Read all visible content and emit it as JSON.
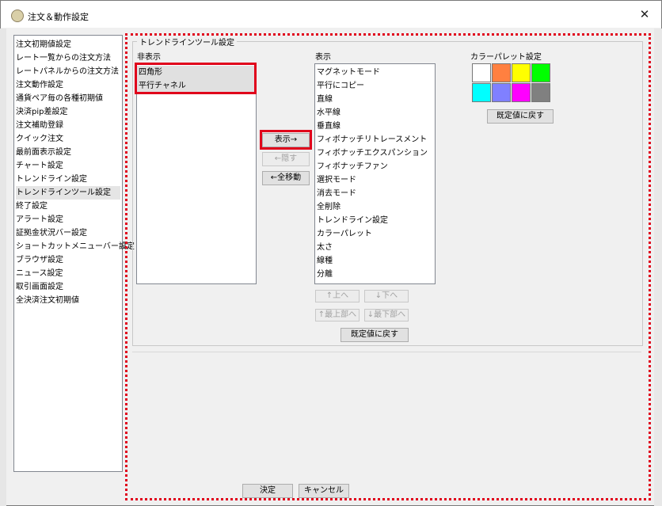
{
  "window": {
    "title": "注文＆動作設定",
    "close_glyph": "✕"
  },
  "nav": {
    "items": [
      {
        "label": "注文初期値設定"
      },
      {
        "label": "レート一覧からの注文方法"
      },
      {
        "label": "レートパネルからの注文方法"
      },
      {
        "label": "注文動作設定"
      },
      {
        "label": "通貨ペア毎の各種初期値"
      },
      {
        "label": "決済pip差設定"
      },
      {
        "label": "注文補助登録"
      },
      {
        "label": "クイック注文"
      },
      {
        "label": "最前面表示設定"
      },
      {
        "label": "チャート設定"
      },
      {
        "label": "トレンドライン設定"
      },
      {
        "label": "トレンドラインツール設定",
        "selected": true
      },
      {
        "label": "終了設定"
      },
      {
        "label": "アラート設定"
      },
      {
        "label": "証拠金状況バー設定"
      },
      {
        "label": "ショートカットメニューバー設定"
      },
      {
        "label": "ブラウザ設定"
      },
      {
        "label": "ニュース設定"
      },
      {
        "label": "取引画面設定"
      },
      {
        "label": "全決済注文初期値"
      }
    ]
  },
  "panel": {
    "group_title": "トレンドラインツール設定",
    "hidden": {
      "label": "非表示",
      "items": [
        "四角形",
        "平行チャネル"
      ]
    },
    "shown": {
      "label": "表示",
      "items": [
        "マグネットモード",
        "平行にコピー",
        "直線",
        "水平線",
        "垂直線",
        "フィボナッチリトレースメント",
        "フィボナッチエクスパンション",
        "フィボナッチファン",
        "選択モード",
        "消去モード",
        "全削除",
        "トレンドライン設定",
        "カラーパレット",
        "太さ",
        "線種",
        "分離"
      ]
    },
    "buttons": {
      "show": "表示→",
      "hide": "←隠す",
      "move_all": "←全移動",
      "up": "↑上へ",
      "down": "↓下へ",
      "top": "↑最上部へ",
      "bottom": "↓最下部へ",
      "reset_list": "既定値に戻す"
    },
    "palette": {
      "label": "カラーパレット設定",
      "colors": [
        "#ffffff",
        "#ff8040",
        "#ffff00",
        "#00ff00",
        "#00ffff",
        "#8080ff",
        "#ff00ff",
        "#808080"
      ],
      "reset": "既定値に戻す"
    }
  },
  "footer": {
    "ok": "決定",
    "cancel": "キャンセル"
  },
  "annotation_color": "#e0001b"
}
